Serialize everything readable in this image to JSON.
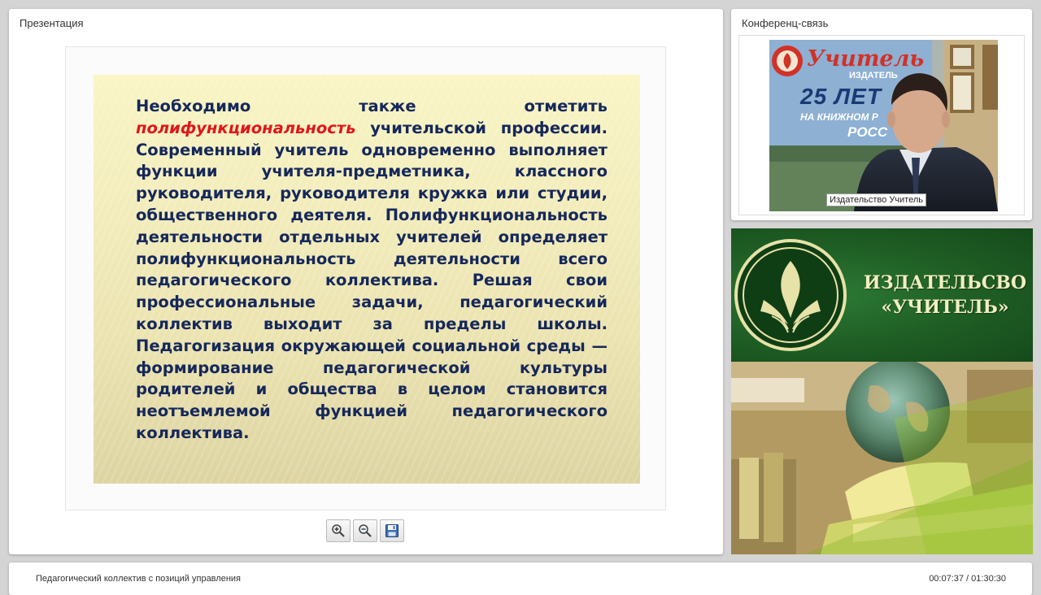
{
  "presentation": {
    "title": "Презентация",
    "slide": {
      "text_p1": "Необходимо также отметить",
      "highlight": "полифункциональность",
      "text_p2": "учительской профессии. Современный учитель одновременно выполняет функции учителя-предметника, классного руководителя, руководителя кружка или студии, общественного деятеля. Полифункциональность деятельности отдельных учителей определяет полифункциональность деятельности всего педагогического коллектива. Решая свои профессиональные задачи, педагогический коллектив выходит за пределы школы. Педагогизация окружающей социальной среды — формирование педагогической культуры родителей и общества в целом становится неотъемлемой функцией педагогического коллектива.",
      "highlight_color": "#e0161b",
      "text_color": "#16285a"
    },
    "toolbar": {
      "zoom_in_icon": "zoom-in-icon",
      "zoom_out_icon": "zoom-out-icon",
      "save_icon": "floppy-disk-icon"
    }
  },
  "conference": {
    "title": "Конференц-связь",
    "video": {
      "participant": "Издательство Учитель",
      "banner_brand": "Учитель",
      "banner_sub": "ИЗДАТЕЛЬ",
      "banner_years": "25 ЛЕТ",
      "banner_line": "НА КНИЖНОМ Р",
      "banner_country": "РОСС"
    }
  },
  "brand": {
    "line1": "ИЗДАТЕЛЬСВО",
    "line2": "«УЧИТЕЛЬ»",
    "green": "#1f5f25",
    "cream": "#f2eec0"
  },
  "footer": {
    "course_title": "Педагогический коллектив с позиций управления",
    "time": "00:07:37 / 01:30:30"
  }
}
